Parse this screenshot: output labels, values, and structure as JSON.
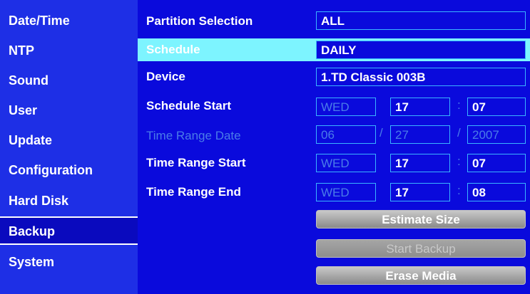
{
  "sidebar": {
    "items": [
      {
        "label": "Date/Time"
      },
      {
        "label": "NTP"
      },
      {
        "label": "Sound"
      },
      {
        "label": "User"
      },
      {
        "label": "Update"
      },
      {
        "label": "Configuration"
      },
      {
        "label": "Hard Disk"
      },
      {
        "label": "Backup"
      },
      {
        "label": "System"
      }
    ],
    "selected": "Backup"
  },
  "rows": {
    "partition": {
      "label": "Partition Selection",
      "value": "ALL"
    },
    "schedule": {
      "label": "Schedule",
      "value": "DAILY"
    },
    "device": {
      "label": "Device",
      "value": "1.TD Classic 003B"
    },
    "schedule_start": {
      "label": "Schedule Start",
      "day": "WED",
      "hour": "17",
      "minute": "07",
      "sep": ":"
    },
    "time_range_date": {
      "label": "Time Range Date",
      "month": "06",
      "day": "27",
      "year": "2007",
      "sep": "/"
    },
    "time_range_start": {
      "label": "Time Range Start",
      "day": "WED",
      "hour": "17",
      "minute": "07",
      "sep": ":"
    },
    "time_range_end": {
      "label": "Time Range End",
      "day": "WED",
      "hour": "17",
      "minute": "08",
      "sep": ":"
    }
  },
  "buttons": {
    "estimate": "Estimate Size",
    "start": "Start Backup",
    "erase": "Erase Media"
  },
  "colors": {
    "background": "#0a0adc",
    "sidebar": "#1e2fe6",
    "highlight": "#7df4ff",
    "field_border": "#3ab4ff",
    "dim_text": "#4a7ce8"
  }
}
